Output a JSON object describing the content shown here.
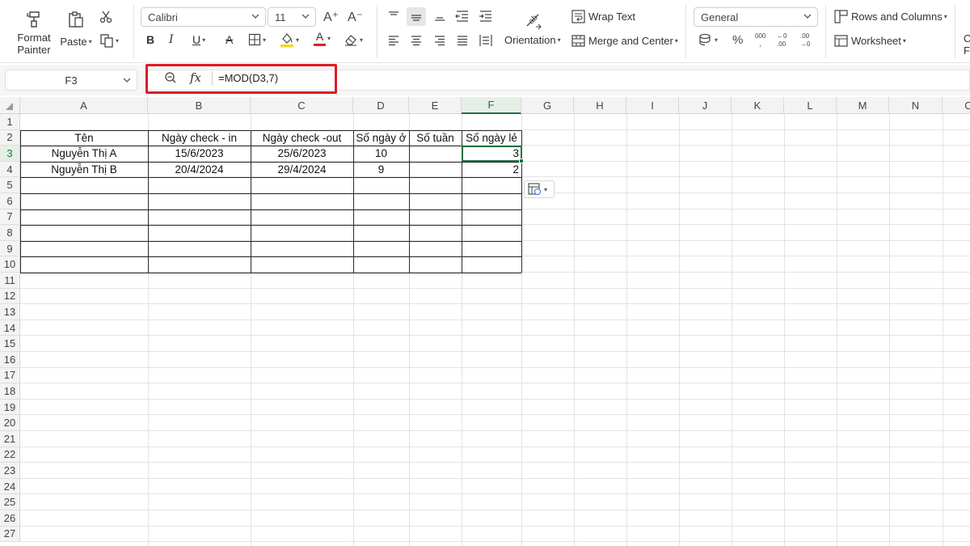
{
  "ribbon": {
    "format_painter": {
      "line1": "Format",
      "line2": "Painter",
      "icon": "format-painter-icon"
    },
    "paste": {
      "label": "Paste",
      "icon": "clipboard-icon"
    },
    "cut_icon": "scissors-icon",
    "copy_icon": "copy-icon",
    "font": {
      "name": "Calibri",
      "size": "11"
    },
    "increase_font": "A⁺",
    "decrease_font": "A⁻",
    "bold": "B",
    "italic": "I",
    "underline": "U",
    "strikethrough": "A",
    "font_color_letter": "A",
    "wrap_text": "Wrap Text",
    "orientation": "Orientation",
    "merge_center": "Merge and Center",
    "number_format": "General",
    "percent": "%",
    "comma": "000",
    "inc_decimal": ".00",
    "dec_decimal": ".00",
    "rows_columns": "Rows and Columns",
    "worksheet": "Worksheet",
    "cut_off_top": "C",
    "cut_off_bottom": "F",
    "colors": {
      "highlight": "#f5d327",
      "font_red": "#e01b24",
      "accent_green": "#1e7145"
    }
  },
  "formula_bar": {
    "name_box": "F3",
    "fx": "fx",
    "formula": "=MOD(D3,7)",
    "highlight_color": "#e01b24"
  },
  "columns": [
    "A",
    "B",
    "C",
    "D",
    "E",
    "F",
    "G",
    "H",
    "I",
    "J",
    "K",
    "L",
    "M",
    "N",
    "C"
  ],
  "rows": [
    "1",
    "2",
    "3",
    "4",
    "5",
    "6",
    "7",
    "8",
    "9",
    "10",
    "11",
    "12",
    "13",
    "14",
    "15",
    "16",
    "17",
    "18",
    "19",
    "20",
    "21",
    "22",
    "23",
    "24",
    "25",
    "26",
    "27"
  ],
  "selected_cell": {
    "column": "F",
    "row": "3"
  },
  "table": {
    "headers": [
      "Tên",
      "Ngày check - in",
      "Ngày check -out",
      "Số ngày ở",
      "Số tuần",
      "Số ngày lẻ"
    ],
    "rows": [
      [
        "Nguyễn Thị A",
        "15/6/2023",
        "25/6/2023",
        "10",
        "",
        "3"
      ],
      [
        "Nguyễn Thị B",
        "20/4/2024",
        "29/4/2024",
        "9",
        "",
        "2"
      ]
    ]
  },
  "paste_options_icon": "paste-options-icon"
}
